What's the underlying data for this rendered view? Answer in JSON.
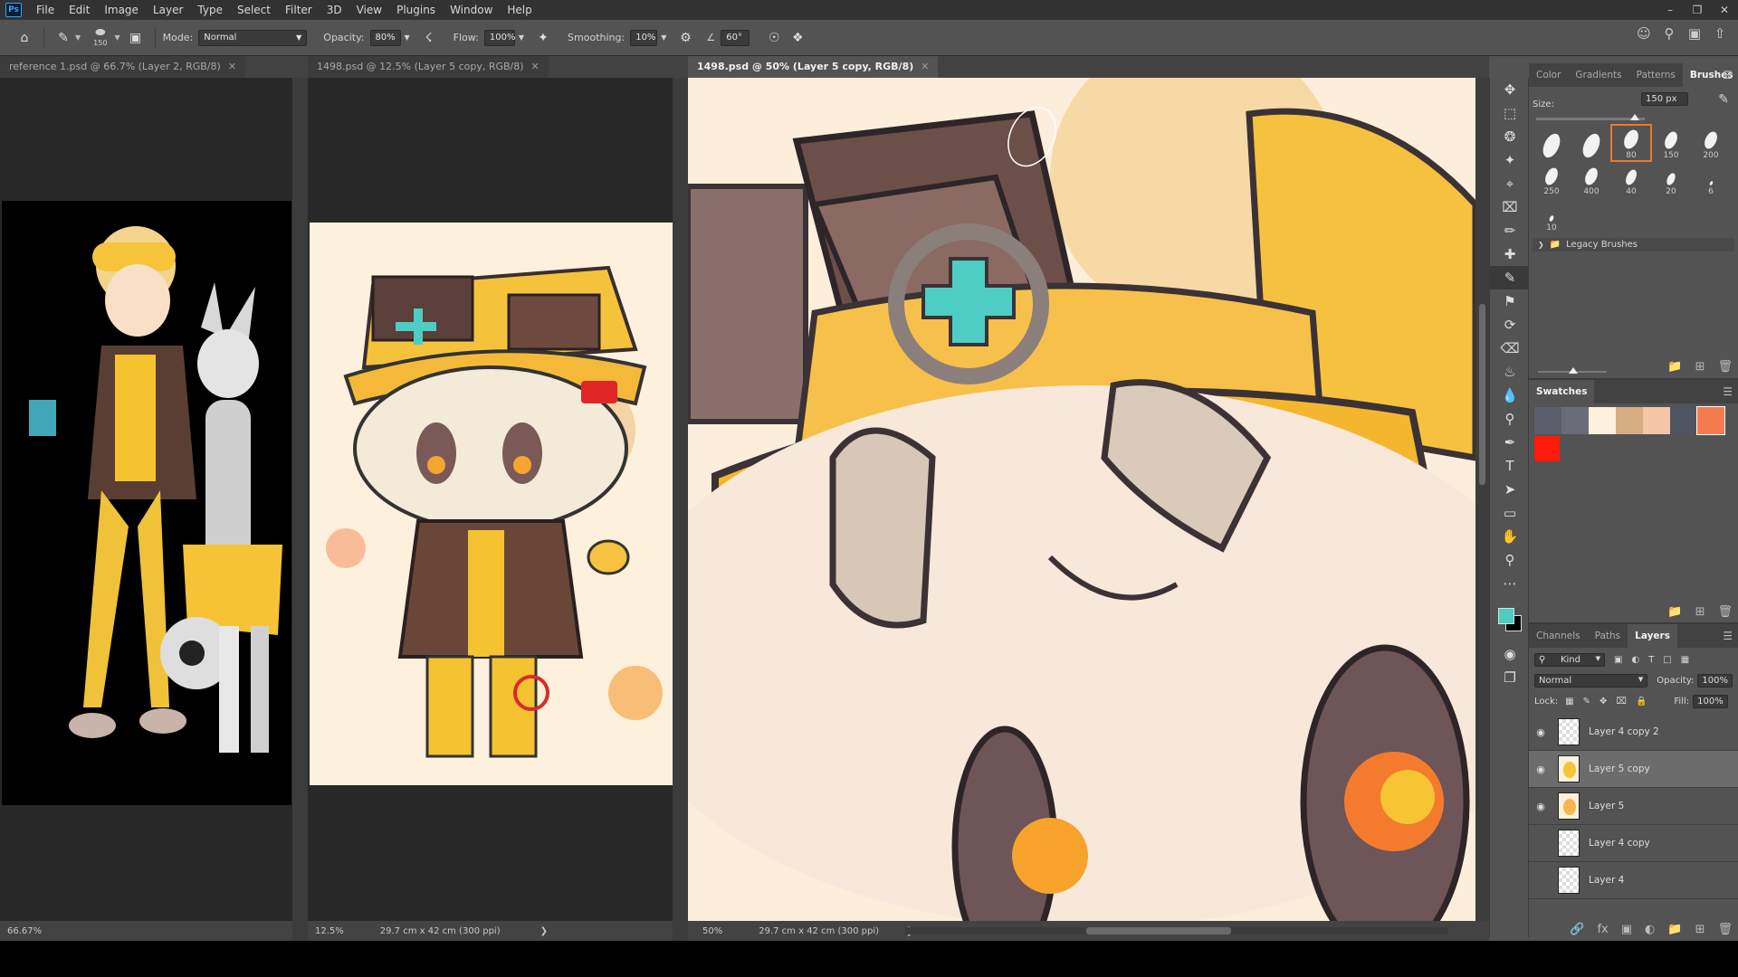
{
  "menu": {
    "logo": "Ps",
    "items": [
      "File",
      "Edit",
      "Image",
      "Layer",
      "Type",
      "Select",
      "Filter",
      "3D",
      "View",
      "Plugins",
      "Window",
      "Help"
    ]
  },
  "options": {
    "brush_size": "150",
    "mode_label": "Mode:",
    "mode_value": "Normal",
    "opacity_label": "Opacity:",
    "opacity_value": "80%",
    "flow_label": "Flow:",
    "flow_value": "100%",
    "smoothing_label": "Smoothing:",
    "smoothing_value": "10%",
    "angle_value": "60°"
  },
  "documents": [
    {
      "tab": "reference 1.psd @ 66.7% (Layer 2, RGB/8)",
      "zoom": "66.67%",
      "size": ""
    },
    {
      "tab": "1498.psd @ 12.5% (Layer 5 copy, RGB/8)",
      "zoom": "12.5%",
      "size": "29.7 cm x 42 cm (300 ppi)"
    },
    {
      "tab": "1498.psd @ 50% (Layer 5 copy, RGB/8)",
      "zoom": "50%",
      "size": "29.7 cm x 42 cm (300 ppi)"
    }
  ],
  "brushes_panel": {
    "tabs": [
      "Color",
      "Gradients",
      "Patterns",
      "Brushes"
    ],
    "active_tab": "Brushes",
    "size_label": "Size:",
    "size_value": "150 px",
    "presets": [
      "",
      "",
      "80",
      "150",
      "200",
      "250",
      "400",
      "40",
      "20",
      "6",
      "10"
    ],
    "folder": "Legacy Brushes"
  },
  "swatches_panel": {
    "title": "Swatches",
    "colors": [
      "#5c5f6b",
      "#6a6d78",
      "#fdf0dc",
      "#d6ad82",
      "#f4c6a8",
      "#4f5462",
      "#f47b4d",
      "#ff1a0a"
    ]
  },
  "layers_panel": {
    "tabs": [
      "Channels",
      "Paths",
      "Layers"
    ],
    "active_tab": "Layers",
    "kind_label": "Kind",
    "blend_mode": "Normal",
    "opacity_label": "Opacity:",
    "opacity_value": "100%",
    "lock_label": "Lock:",
    "fill_label": "Fill:",
    "fill_value": "100%",
    "layers": [
      {
        "name": "Layer 4 copy 2",
        "visible": true,
        "active": false
      },
      {
        "name": "Layer 5 copy",
        "visible": true,
        "active": true
      },
      {
        "name": "Layer 5",
        "visible": true,
        "active": false
      },
      {
        "name": "Layer 4 copy",
        "visible": false,
        "active": false
      },
      {
        "name": "Layer 4",
        "visible": false,
        "active": false
      }
    ]
  },
  "colors": {
    "foreground": "#4ecdc4",
    "background": "#000000",
    "accent": "#e87a30"
  }
}
